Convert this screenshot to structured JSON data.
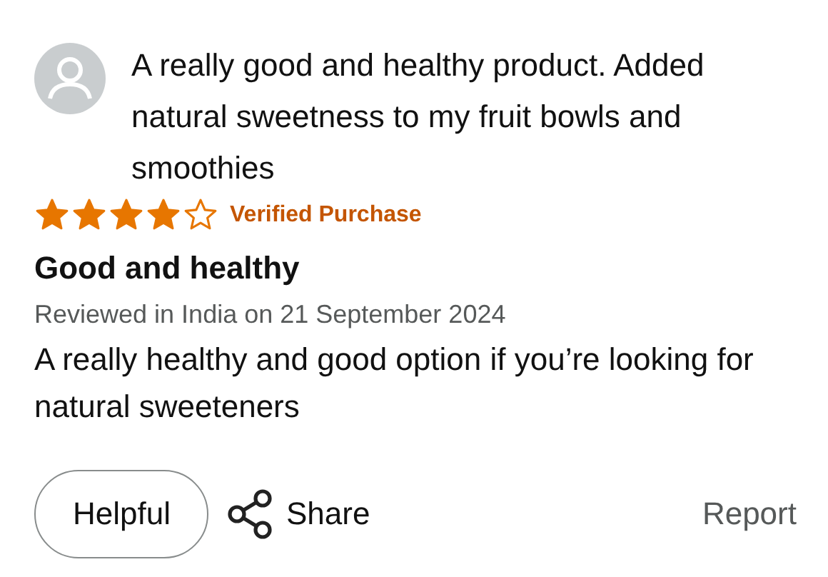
{
  "review": {
    "summary": "A really good and healthy product. Added natural sweetness to my fruit bowls and smoothies",
    "stars": 4,
    "badge": "Verified Purchase",
    "title": "Good and healthy",
    "meta": "Reviewed in India on 21 September 2024",
    "body": "A really healthy and good option if you’re looking for natural sweeteners"
  },
  "actions": {
    "helpful": "Helpful",
    "share": "Share",
    "report": "Report"
  }
}
